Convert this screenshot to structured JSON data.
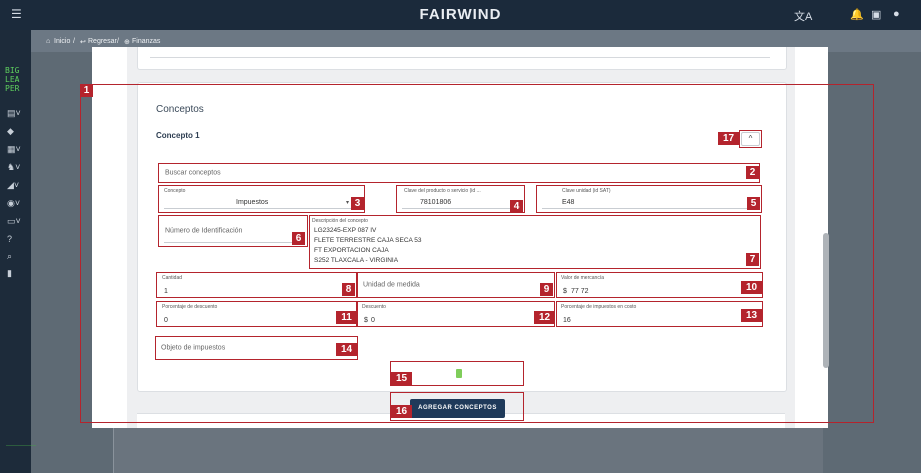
{
  "header": {
    "brand": "FAIRWIND",
    "translate_icon": "translate-icon",
    "bell_icon": "bell-icon",
    "chat_icon": "chat-icon",
    "account_icon": "account-icon",
    "menu_icon": "menu-icon"
  },
  "sidebar": {
    "logo": [
      "BIG",
      "LEA",
      "PER"
    ],
    "items": [
      "document-icon",
      "tag-icon",
      "chart-icon",
      "person-icon",
      "truck-icon",
      "wallet-icon",
      "card-icon",
      "help-icon",
      "search-icon",
      "map-icon"
    ],
    "footer": "——————"
  },
  "breadcrumb": {
    "home": "Inicio",
    "sep1": "/",
    "back": "Regresar",
    "sep2": "/",
    "current": "Finanzas"
  },
  "section": {
    "title": "Conceptos",
    "concept_title": "Concepto 1",
    "collapse_icon": "^"
  },
  "fields": {
    "buscar_placeholder": "Buscar conceptos",
    "concepto_label": "Concepto",
    "concepto_value": "Impuestos",
    "clave_producto_label": "Clave del producto o servicio (id ...",
    "clave_producto_value": "78101806",
    "clave_unidad_label": "Clave unidad (id SAT)",
    "clave_unidad_value": "E48",
    "numero_id_placeholder": "Número de Identificación",
    "descripcion_label": "Descripción del concepto",
    "descripcion_lines": [
      "LG23245-EXP 087 IV",
      "FLETE TERRESTRE CAJA SECA 53",
      "FT EXPORTACION CAJA",
      "S252 TLAXCALA - VIRGINIA"
    ],
    "cantidad_label": "Cantidad",
    "cantidad_value": "1",
    "unidad_placeholder": "Unidad de medida",
    "valor_label": "Valor de mercancía",
    "valor_prefix": "$",
    "valor_value": "77 72",
    "porc_desc_label": "Porcentaje de descuento",
    "porc_desc_value": "0",
    "descuento_label": "Descuento",
    "descuento_prefix": "$",
    "descuento_value": "0",
    "porc_imp_label": "Porcentaje de impuestos en costo",
    "porc_imp_value": "16",
    "objeto_placeholder": "Objeto de impuestos"
  },
  "buttons": {
    "add": "AGREGAR CONCEPTOS"
  },
  "annotations": [
    "1",
    "2",
    "3",
    "4",
    "5",
    "6",
    "7",
    "8",
    "9",
    "10",
    "11",
    "12",
    "13",
    "14",
    "15",
    "16",
    "17"
  ],
  "colors": {
    "annotation": "#b4242d",
    "header": "#1b2a3b",
    "button": "#1f3a5a"
  }
}
